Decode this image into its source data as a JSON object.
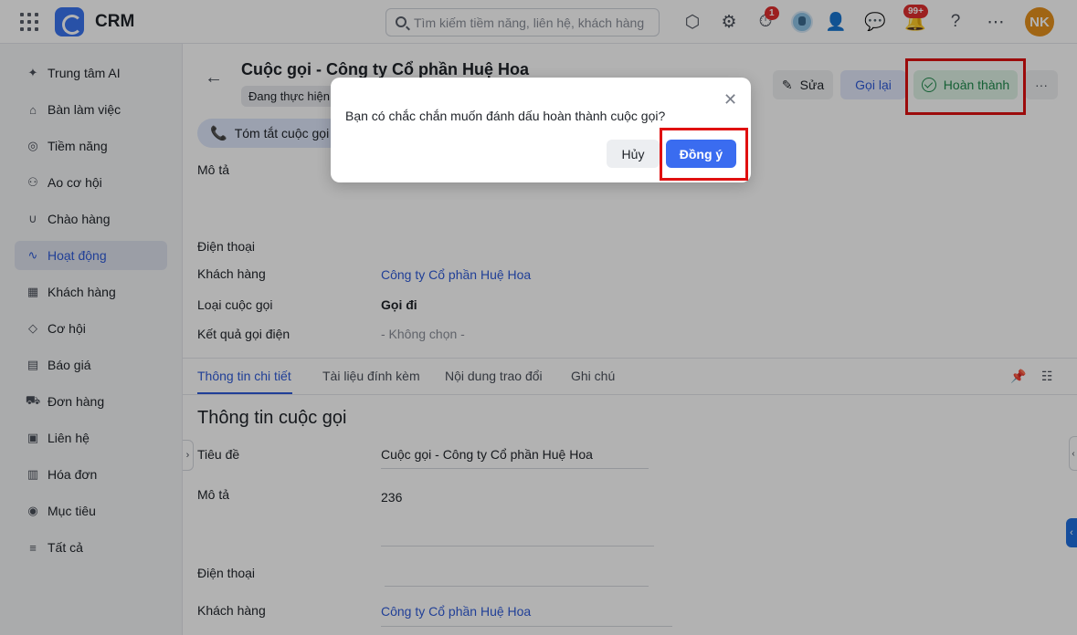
{
  "topbar": {
    "app_name": "CRM",
    "search_placeholder": "Tìm kiếm tiềm năng, liên hệ, khách hàng",
    "timer_badge": "1",
    "bell_badge": "99+",
    "avatar_initials": "NK"
  },
  "sidebar": {
    "items": [
      {
        "label": "Trung tâm AI",
        "icon": "sparkle-icon"
      },
      {
        "label": "Bàn làm việc",
        "icon": "home-icon"
      },
      {
        "label": "Tiềm năng",
        "icon": "lead-icon"
      },
      {
        "label": "Ao cơ hội",
        "icon": "users-icon"
      },
      {
        "label": "Chào hàng",
        "icon": "magnet-icon"
      },
      {
        "label": "Hoạt động",
        "icon": "activity-icon"
      },
      {
        "label": "Khách hàng",
        "icon": "building-icon"
      },
      {
        "label": "Cơ hội",
        "icon": "opportunity-icon"
      },
      {
        "label": "Báo giá",
        "icon": "quote-icon"
      },
      {
        "label": "Đơn hàng",
        "icon": "cart-icon"
      },
      {
        "label": "Liên hệ",
        "icon": "contact-icon"
      },
      {
        "label": "Hóa đơn",
        "icon": "invoice-icon"
      },
      {
        "label": "Mục tiêu",
        "icon": "target-icon"
      },
      {
        "label": "Tất cả",
        "icon": "menu-icon"
      }
    ],
    "active_index": 5
  },
  "record": {
    "title": "Cuộc gọi - Công ty Cổ phần Huệ Hoa",
    "status": "Đang thực hiện",
    "buttons": {
      "edit": "Sửa",
      "recall": "Gọi lại",
      "complete": "Hoàn thành",
      "more": "···"
    },
    "summary_chip": "Tóm tắt cuộc gọi với AI"
  },
  "top_fields": {
    "description_label": "Mô tả",
    "phone_label": "Điện thoại",
    "customer_label": "Khách hàng",
    "customer_value": "Công ty Cổ phần Huệ Hoa",
    "call_type_label": "Loại cuộc gọi",
    "call_type_value": "Gọi đi",
    "call_result_label": "Kết quả gọi điện",
    "call_result_value": "- Không chọn -"
  },
  "tabs": [
    "Thông tin chi tiết",
    "Tài liệu đính kèm",
    "Nội dung trao đổi",
    "Ghi chú"
  ],
  "detail": {
    "section_title": "Thông tin cuộc gọi",
    "subject_label": "Tiêu đề",
    "subject_value": "Cuộc gọi - Công ty Cổ phần Huệ Hoa",
    "description_label": "Mô tả",
    "description_value": "236",
    "phone_label": "Điện thoại",
    "customer_label": "Khách hàng",
    "customer_value": "Công ty Cổ phần Huệ Hoa"
  },
  "dialog": {
    "message": "Bạn có chắc chắn muốn đánh dấu hoàn thành cuộc gọi?",
    "cancel_label": "Hủy",
    "confirm_label": "Đồng ý"
  },
  "colors": {
    "accent": "#3a6cf0",
    "highlight_box": "#e01010",
    "complete_green": "#1f8a4c"
  }
}
